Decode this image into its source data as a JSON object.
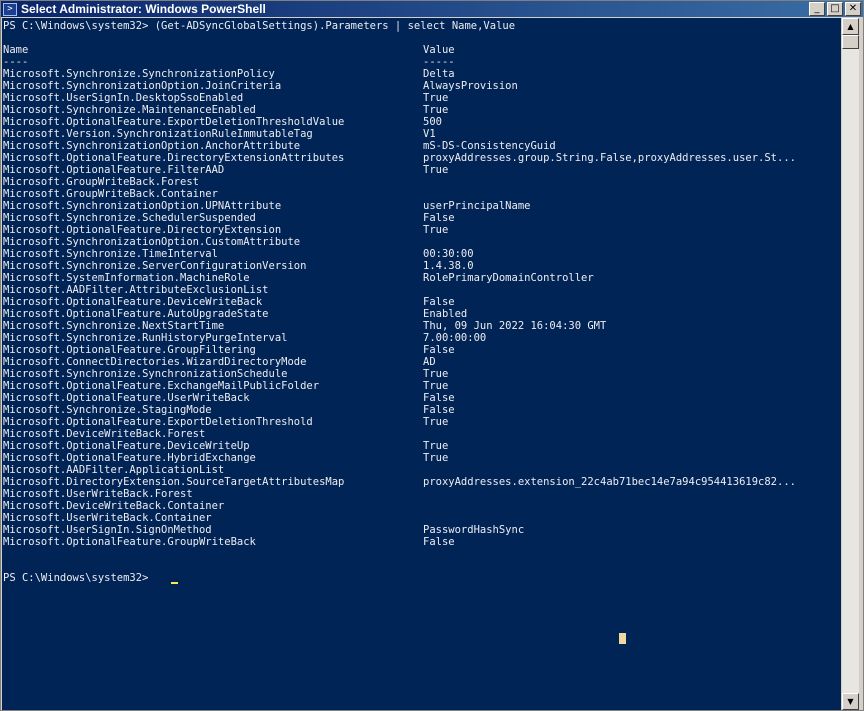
{
  "window": {
    "title": "Select Administrator: Windows PowerShell",
    "minimize": "_",
    "maximize": "□",
    "close": "✕"
  },
  "console": {
    "command_line": "PS C:\\Windows\\system32> (Get-ADSyncGlobalSettings).Parameters | select Name,Value",
    "header": {
      "name": "Name",
      "value": "Value"
    },
    "divider": {
      "name": "----",
      "value": "-----"
    },
    "rows": [
      {
        "name": "Microsoft.Synchronize.SynchronizationPolicy",
        "value": "Delta"
      },
      {
        "name": "Microsoft.SynchronizationOption.JoinCriteria",
        "value": "AlwaysProvision"
      },
      {
        "name": "Microsoft.UserSignIn.DesktopSsoEnabled",
        "value": "True"
      },
      {
        "name": "Microsoft.Synchronize.MaintenanceEnabled",
        "value": "True"
      },
      {
        "name": "Microsoft.OptionalFeature.ExportDeletionThresholdValue",
        "value": "500"
      },
      {
        "name": "Microsoft.Version.SynchronizationRuleImmutableTag",
        "value": "V1"
      },
      {
        "name": "Microsoft.SynchronizationOption.AnchorAttribute",
        "value": "mS-DS-ConsistencyGuid"
      },
      {
        "name": "Microsoft.OptionalFeature.DirectoryExtensionAttributes",
        "value": "proxyAddresses.group.String.False,proxyAddresses.user.St..."
      },
      {
        "name": "Microsoft.OptionalFeature.FilterAAD",
        "value": "True"
      },
      {
        "name": "Microsoft.GroupWriteBack.Forest",
        "value": ""
      },
      {
        "name": "Microsoft.GroupWriteBack.Container",
        "value": ""
      },
      {
        "name": "Microsoft.SynchronizationOption.UPNAttribute",
        "value": "userPrincipalName"
      },
      {
        "name": "Microsoft.Synchronize.SchedulerSuspended",
        "value": "False"
      },
      {
        "name": "Microsoft.OptionalFeature.DirectoryExtension",
        "value": "True"
      },
      {
        "name": "Microsoft.SynchronizationOption.CustomAttribute",
        "value": ""
      },
      {
        "name": "Microsoft.Synchronize.TimeInterval",
        "value": "00:30:00"
      },
      {
        "name": "Microsoft.Synchronize.ServerConfigurationVersion",
        "value": "1.4.38.0"
      },
      {
        "name": "Microsoft.SystemInformation.MachineRole",
        "value": "RolePrimaryDomainController"
      },
      {
        "name": "Microsoft.AADFilter.AttributeExclusionList",
        "value": ""
      },
      {
        "name": "Microsoft.OptionalFeature.DeviceWriteBack",
        "value": "False"
      },
      {
        "name": "Microsoft.OptionalFeature.AutoUpgradeState",
        "value": "Enabled"
      },
      {
        "name": "Microsoft.Synchronize.NextStartTime",
        "value": "Thu, 09 Jun 2022 16:04:30 GMT"
      },
      {
        "name": "Microsoft.Synchronize.RunHistoryPurgeInterval",
        "value": "7.00:00:00"
      },
      {
        "name": "Microsoft.OptionalFeature.GroupFiltering",
        "value": "False"
      },
      {
        "name": "Microsoft.ConnectDirectories.WizardDirectoryMode",
        "value": "AD"
      },
      {
        "name": "Microsoft.Synchronize.SynchronizationSchedule",
        "value": "True"
      },
      {
        "name": "Microsoft.OptionalFeature.ExchangeMailPublicFolder",
        "value": "True"
      },
      {
        "name": "Microsoft.OptionalFeature.UserWriteBack",
        "value": "False"
      },
      {
        "name": "Microsoft.Synchronize.StagingMode",
        "value": "False"
      },
      {
        "name": "Microsoft.OptionalFeature.ExportDeletionThreshold",
        "value": "True"
      },
      {
        "name": "Microsoft.DeviceWriteBack.Forest",
        "value": ""
      },
      {
        "name": "Microsoft.OptionalFeature.DeviceWriteUp",
        "value": "True"
      },
      {
        "name": "Microsoft.OptionalFeature.HybridExchange",
        "value": "True"
      },
      {
        "name": "Microsoft.AADFilter.ApplicationList",
        "value": ""
      },
      {
        "name": "Microsoft.DirectoryExtension.SourceTargetAttributesMap",
        "value": "proxyAddresses.extension_22c4ab71bec14e7a94c954413619c82..."
      },
      {
        "name": "Microsoft.UserWriteBack.Forest",
        "value": ""
      },
      {
        "name": "Microsoft.DeviceWriteBack.Container",
        "value": ""
      },
      {
        "name": "Microsoft.UserWriteBack.Container",
        "value": ""
      },
      {
        "name": "Microsoft.UserSignIn.SignOnMethod",
        "value": "PasswordHashSync"
      },
      {
        "name": "Microsoft.OptionalFeature.GroupWriteBack",
        "value": "False"
      }
    ],
    "prompt": "PS C:\\Windows\\system32> "
  },
  "scrollbar": {
    "up_arrow": "▲",
    "down_arrow": "▼"
  },
  "colors": {
    "console_bg": "#012456",
    "console_fg": "#eeedf0",
    "titlebar_start": "#0a246a",
    "titlebar_end": "#3a6ea5",
    "cursor": "#fce94f"
  }
}
